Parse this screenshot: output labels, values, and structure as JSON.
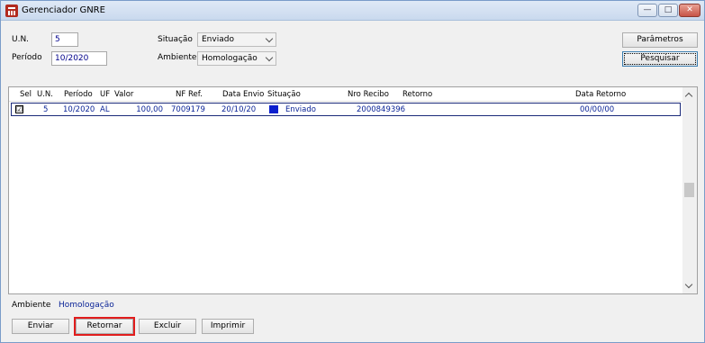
{
  "window": {
    "title": "Gerenciador GNRE"
  },
  "filters": {
    "un_label": "U.N.",
    "un_value": "5",
    "periodo_label": "Período",
    "periodo_value": "10/2020",
    "situacao_label": "Situação",
    "situacao_value": "Enviado",
    "ambiente_label": "Ambiente",
    "ambiente_value": "Homologação"
  },
  "buttons": {
    "parametros": "Parâmetros",
    "pesquisar": "Pesquisar",
    "enviar": "Enviar",
    "retornar": "Retornar",
    "excluir": "Excluir",
    "imprimir": "Imprimir"
  },
  "table": {
    "columns": [
      "Sel",
      "U.N.",
      "Período",
      "UF",
      "Valor",
      "NF Ref.",
      "Data Envio",
      "Situação",
      "Nro Recibo",
      "Retorno",
      "Data Retorno"
    ],
    "rows": [
      {
        "sel": "☑",
        "un": "5",
        "periodo": "10/2020",
        "uf": "AL",
        "valor": "100,00",
        "nf_ref": "7009179",
        "data_envio": "20/10/20",
        "situacao": "Enviado",
        "situacao_color": "#0b1fce",
        "nro_recibo": "2000849396",
        "retorno": "",
        "data_retorno": "00/00/00"
      }
    ]
  },
  "footer": {
    "ambiente_label": "Ambiente",
    "ambiente_value": "Homologação"
  },
  "colors": {
    "title_bar": "#c9d9ee",
    "highlight_border": "#e11d1d",
    "data_text": "#0b2497"
  }
}
